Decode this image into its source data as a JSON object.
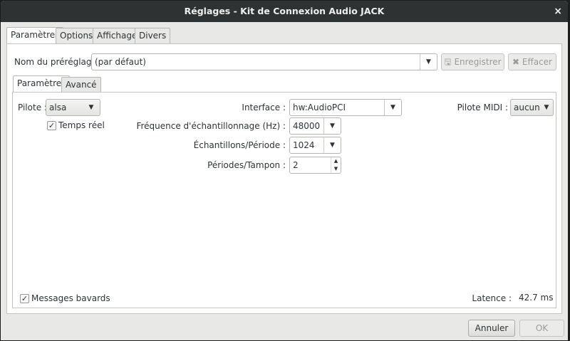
{
  "window": {
    "title": "Réglages - Kit de Connexion Audio JACK",
    "close": "×"
  },
  "outer_tabs": [
    "Paramètres",
    "Options",
    "Affichage",
    "Divers"
  ],
  "preset": {
    "label": "Nom du préréglage :",
    "value": "(par défaut)",
    "save": "Enregistrer",
    "delete": "Effacer"
  },
  "inner_tabs": [
    "Paramètres",
    "Avancé"
  ],
  "params": {
    "driver_label": "Pilote :",
    "driver": "alsa",
    "realtime_label": "Temps réel",
    "realtime_checked": true,
    "interface_label": "Interface :",
    "interface": "hw:AudioPCI",
    "rate_label": "Fréquence d'échantillonnage (Hz) :",
    "rate": "48000",
    "frames_label": "Échantillons/Période :",
    "frames": "1024",
    "periods_label": "Périodes/Tampon :",
    "periods": "2",
    "midi_label": "Pilote MIDI :",
    "midi": "aucun",
    "verbose_label": "Messages bavards",
    "verbose_checked": true,
    "latency_label": "Latence :",
    "latency": "42.7 ms"
  },
  "buttons": {
    "cancel": "Annuler",
    "ok": "OK"
  }
}
